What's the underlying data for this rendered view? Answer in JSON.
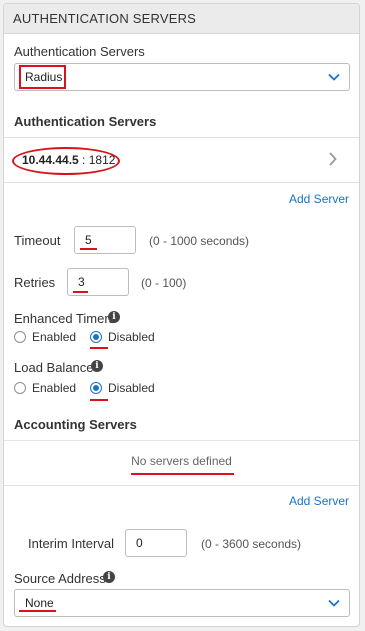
{
  "header": {
    "title": "AUTHENTICATION SERVERS"
  },
  "auth_type": {
    "label": "Authentication Servers",
    "selected": "Radius"
  },
  "auth_servers": {
    "title": "Authentication Servers",
    "server_ip": "10.44.44.5",
    "server_sep": " : ",
    "server_port": "1812",
    "add_label": "Add Server"
  },
  "timeout": {
    "label": "Timeout",
    "value": "5",
    "hint": "(0 - 1000 seconds)"
  },
  "retries": {
    "label": "Retries",
    "value": "3",
    "hint": "(0 - 100)"
  },
  "enhanced_timers": {
    "label": "Enhanced Timers",
    "options": [
      "Enabled",
      "Disabled"
    ],
    "selected": "Disabled"
  },
  "load_balance": {
    "label": "Load Balance",
    "options": [
      "Enabled",
      "Disabled"
    ],
    "selected": "Disabled"
  },
  "accounting_servers": {
    "title": "Accounting Servers",
    "empty_text": "No servers defined",
    "add_label": "Add Server"
  },
  "interim_interval": {
    "label": "Interim Interval",
    "value": "0",
    "hint": "(0 - 3600 seconds)"
  },
  "source_address": {
    "label": "Source Address",
    "selected": "None"
  },
  "colors": {
    "accent": "#1a73c8",
    "annotation": "#d9121b"
  },
  "icons": [
    "chevron-down-icon",
    "chevron-right-icon",
    "info-icon"
  ]
}
